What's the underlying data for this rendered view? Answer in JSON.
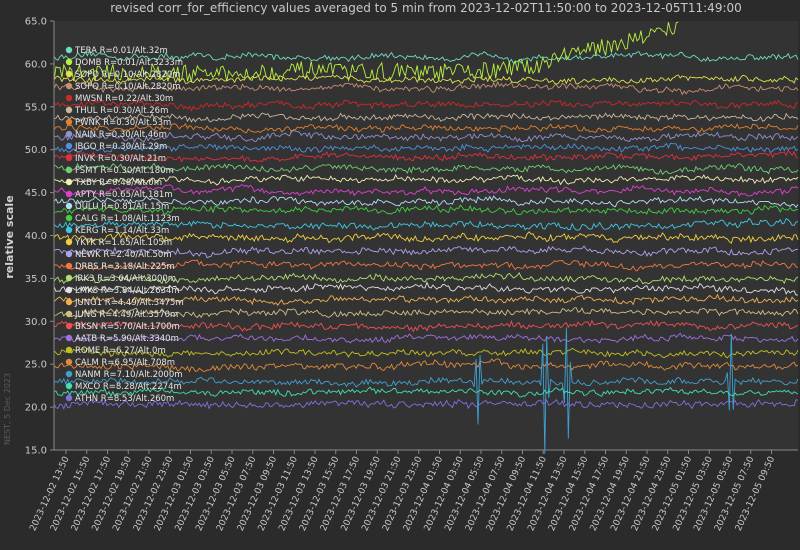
{
  "chart_data": {
    "type": "line",
    "title": "revised corr_for_efficiency values averaged to 5 min from 2023-12-02T11:50:00 to 2023-12-05T11:49:00",
    "ylabel": "relative scale",
    "xlabel": "",
    "ylim": [
      15,
      65
    ],
    "yticks": [
      "15.0",
      "20.0",
      "25.0",
      "30.0",
      "35.0",
      "40.0",
      "45.0",
      "50.0",
      "55.0",
      "60.0",
      "65.0"
    ],
    "xticks": [
      "2023-12-02 13:50",
      "2023-12-02 15:50",
      "2023-12-02 17:50",
      "2023-12-02 19:50",
      "2023-12-02 21:50",
      "2023-12-02 23:50",
      "2023-12-03 01:50",
      "2023-12-03 03:50",
      "2023-12-03 05:50",
      "2023-12-03 07:50",
      "2023-12-03 09:50",
      "2023-12-03 11:50",
      "2023-12-03 13:50",
      "2023-12-03 15:50",
      "2023-12-03 17:50",
      "2023-12-03 19:50",
      "2023-12-03 21:50",
      "2023-12-03 23:50",
      "2023-12-04 01:50",
      "2023-12-04 03:50",
      "2023-12-04 05:50",
      "2023-12-04 07:50",
      "2023-12-04 09:50",
      "2023-12-04 11:50",
      "2023-12-04 13:50",
      "2023-12-04 15:50",
      "2023-12-04 17:50",
      "2023-12-04 19:50",
      "2023-12-04 21:50",
      "2023-12-04 23:50",
      "2023-12-05 01:50",
      "2023-12-05 03:50",
      "2023-12-05 05:50",
      "2023-12-05 07:50",
      "2023-12-05 09:50"
    ],
    "grid": false,
    "legend_position": "top-left",
    "watermark": "NEST, 5 Dec 2023",
    "series": [
      {
        "name": "TERA R=0.01/Alt.32m",
        "color": "#6ddcc0",
        "level": 60.8,
        "noise": 0.3
      },
      {
        "name": "DOMB R=0.01/Alt.3233m",
        "color": "#b8f040",
        "level": 59.0,
        "noise": 1.0,
        "ramp": {
          "from": 0.6,
          "to": 0.84,
          "rise": 5.5
        }
      },
      {
        "name": "SOPO R=0.10/Alt.2820m",
        "color": "#e0e050",
        "level": 58.2,
        "noise": 0.3
      },
      {
        "name": "SOPQ R=0.10/Alt.2820m",
        "color": "#c89070",
        "level": 57.2,
        "noise": 0.3
      },
      {
        "name": "MWSN R=0.22/Alt.30m",
        "color": "#d02828",
        "level": 55.2,
        "noise": 0.3
      },
      {
        "name": "THUL R=0.30/Alt.26m",
        "color": "#c8b8a0",
        "level": 53.8,
        "noise": 0.3
      },
      {
        "name": "PWNK R=0.30/Alt.53m",
        "color": "#e08030",
        "level": 52.5,
        "noise": 0.3
      },
      {
        "name": "NAIN R=0.30/Alt.46m",
        "color": "#9090d0",
        "level": 51.5,
        "noise": 0.3
      },
      {
        "name": "JBGO R=0.30/Alt.29m",
        "color": "#5090e0",
        "level": 50.2,
        "noise": 0.3
      },
      {
        "name": "INVK R=0.30/Alt.21m",
        "color": "#e03040",
        "level": 49.2,
        "noise": 0.3
      },
      {
        "name": "FSMT R=0.30/Alt.180m",
        "color": "#70d070",
        "level": 47.8,
        "noise": 0.3
      },
      {
        "name": "TXBY R=0.48/Alt.0m",
        "color": "#f0f0b0",
        "level": 46.5,
        "noise": 0.3
      },
      {
        "name": "APTY R=0.65/Alt.181m",
        "color": "#e040d0",
        "level": 45.2,
        "noise": 0.3
      },
      {
        "name": "OULU R=0.81/Alt.15m",
        "color": "#b0e0f0",
        "level": 44.0,
        "noise": 0.3
      },
      {
        "name": "CALG R=1.08/Alt.1123m",
        "color": "#40d040",
        "level": 43.0,
        "noise": 0.3
      },
      {
        "name": "KERG R=1.14/Alt.33m",
        "color": "#40c8e0",
        "level": 41.2,
        "noise": 0.3
      },
      {
        "name": "YKTK R=1.65/Alt.105m",
        "color": "#f0d040",
        "level": 39.8,
        "noise": 0.35
      },
      {
        "name": "NEWK R=2.40/Alt.50m",
        "color": "#b0a0f0",
        "level": 38.2,
        "noise": 0.3
      },
      {
        "name": "DRBS R=3.18/Alt.225m",
        "color": "#f07840",
        "level": 36.5,
        "noise": 0.3
      },
      {
        "name": "IRK3 R=3.64/Alt.3000m",
        "color": "#b0e070",
        "level": 35.0,
        "noise": 0.3
      },
      {
        "name": "LMKS R=3.84/Alt.2634m",
        "color": "#e0e0e0",
        "level": 33.8,
        "noise": 0.3
      },
      {
        "name": "JUNG1 R=4.49/Alt.3475m",
        "color": "#f0b050",
        "level": 32.5,
        "noise": 0.3
      },
      {
        "name": "JUNG R=4.49/Alt.3570m",
        "color": "#d0c080",
        "level": 31.0,
        "noise": 0.3
      },
      {
        "name": "BKSN R=5.70/Alt.1700m",
        "color": "#f05050",
        "level": 29.5,
        "noise": 0.3
      },
      {
        "name": "AATB R=5.90/Alt.3340m",
        "color": "#a070e0",
        "level": 28.0,
        "noise": 0.3
      },
      {
        "name": "ROME R=6.27/Alt.0m",
        "color": "#c0c020",
        "level": 26.3,
        "noise": 0.3
      },
      {
        "name": "CALM R=6.95/Alt.708m",
        "color": "#e08a3a",
        "level": 24.8,
        "noise": 0.35
      },
      {
        "name": "NANM R=7.10/Alt.2000m",
        "color": "#40a0d0",
        "level": 23.0,
        "noise": 0.3,
        "spikes": [
          {
            "at": 0.57,
            "amp": 5
          },
          {
            "at": 0.66,
            "amp": 9
          },
          {
            "at": 0.69,
            "amp": 8
          },
          {
            "at": 0.91,
            "amp": 6
          }
        ]
      },
      {
        "name": "MXCO R=8.28/Alt.2274m",
        "color": "#40e0b0",
        "level": 21.8,
        "noise": 0.3
      },
      {
        "name": "ATHN R=8.53/Alt.260m",
        "color": "#8070e0",
        "level": 20.3,
        "noise": 0.35
      }
    ]
  }
}
